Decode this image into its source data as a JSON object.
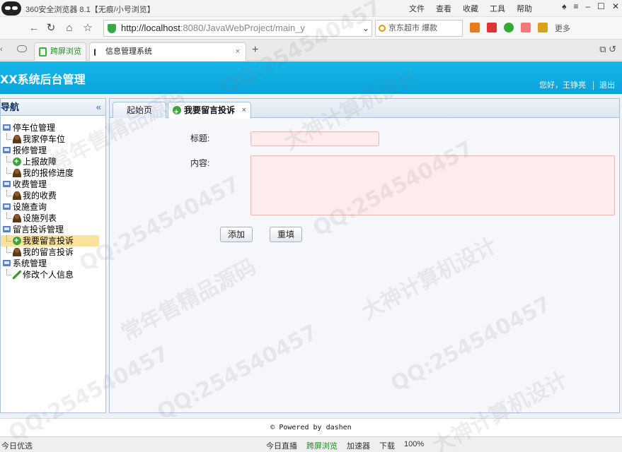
{
  "browser": {
    "title": "360安全浏览器 8.1【无痕/小号浏览】",
    "menus": [
      "文件",
      "查看",
      "收藏",
      "工具",
      "帮助"
    ],
    "url_host": "http://localhost",
    "url_rest": ":8080/JavaWebProject/main_y",
    "search_placeholder": "京东超市 爆款",
    "more_label": "更多",
    "tabs": [
      {
        "label": "跨屏浏览"
      },
      {
        "label": "信息管理系统"
      }
    ]
  },
  "app": {
    "system_title": "XX系统后台管理",
    "greeting": "您好，王铮亮",
    "logout": "退出"
  },
  "sidebar": {
    "title": "导航",
    "collapse_glyph": "«",
    "groups": [
      {
        "label": "停车位管理",
        "items": [
          {
            "label": "我家停车位",
            "icon": "user-icon"
          }
        ]
      },
      {
        "label": "报修管理",
        "items": [
          {
            "label": "上报故障",
            "icon": "add-icon"
          },
          {
            "label": "我的报修进度",
            "icon": "user-icon"
          }
        ]
      },
      {
        "label": "收费管理",
        "items": [
          {
            "label": "我的收费",
            "icon": "user-icon"
          }
        ]
      },
      {
        "label": "设施查询",
        "items": [
          {
            "label": "设施列表",
            "icon": "user-icon"
          }
        ]
      },
      {
        "label": "留言投诉管理",
        "items": [
          {
            "label": "我要留言投诉",
            "icon": "add-icon",
            "selected": true
          },
          {
            "label": "我的留言投诉",
            "icon": "user-icon"
          }
        ]
      },
      {
        "label": "系统管理",
        "items": [
          {
            "label": "修改个人信息",
            "icon": "pencil-icon"
          }
        ]
      }
    ]
  },
  "content_tabs": [
    {
      "label": "起始页"
    },
    {
      "label": "我要留言投诉",
      "active": true
    }
  ],
  "form": {
    "title_label": "标题:",
    "title_value": "",
    "content_label": "内容:",
    "content_value": "",
    "add_button": "添加",
    "reset_button": "重填"
  },
  "footer": {
    "text": "Powered by dashen"
  },
  "statusbar": {
    "left": "今日优选",
    "items": [
      "今日直播",
      "跨屏浏览",
      "加速器",
      "下载",
      "100%"
    ]
  },
  "watermarks": [
    "QQ:254540457",
    "大神计算机设计",
    "常年售精品源码"
  ]
}
